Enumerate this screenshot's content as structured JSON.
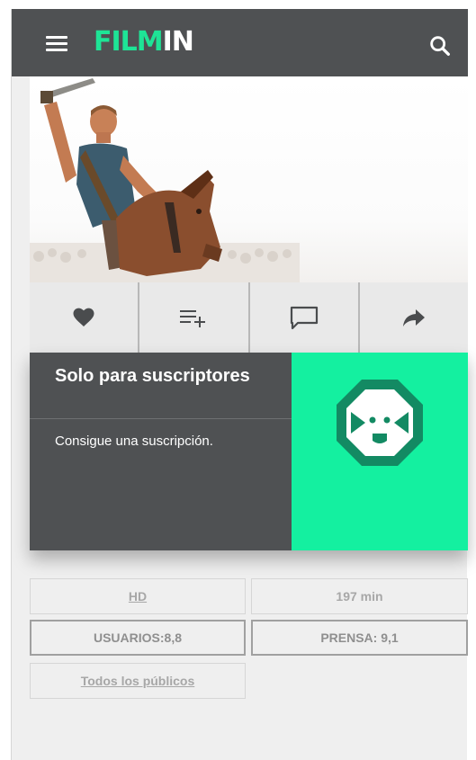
{
  "header": {
    "logo_film": "FILM",
    "logo_in": "IN",
    "menu_icon": "hamburger-menu-icon",
    "search_icon": "search-icon"
  },
  "hero": {
    "image_subject": "gladiator on horseback raising a sword"
  },
  "actions": [
    {
      "name": "favorite",
      "icon": "heart-icon"
    },
    {
      "name": "add-to-list",
      "icon": "playlist-add-icon"
    },
    {
      "name": "comments",
      "icon": "comment-icon"
    },
    {
      "name": "share",
      "icon": "share-arrow-icon"
    }
  ],
  "subscription_card": {
    "title": "Solo para suscriptores",
    "subtitle": "Consigue una suscripción.",
    "mascot_icon": "filmin-dog-mascot-icon"
  },
  "details": {
    "quality": "HD",
    "duration": "197 min",
    "user_rating": "USUARIOS:8,8",
    "press_rating": "PRENSA: 9,1",
    "age_rating": "Todos los públicos"
  },
  "colors": {
    "topbar": "#4f5153",
    "accent": "#14f0a0",
    "logo_green": "#1ee496",
    "card_dark": "#4f5153",
    "background": "#efefef"
  }
}
